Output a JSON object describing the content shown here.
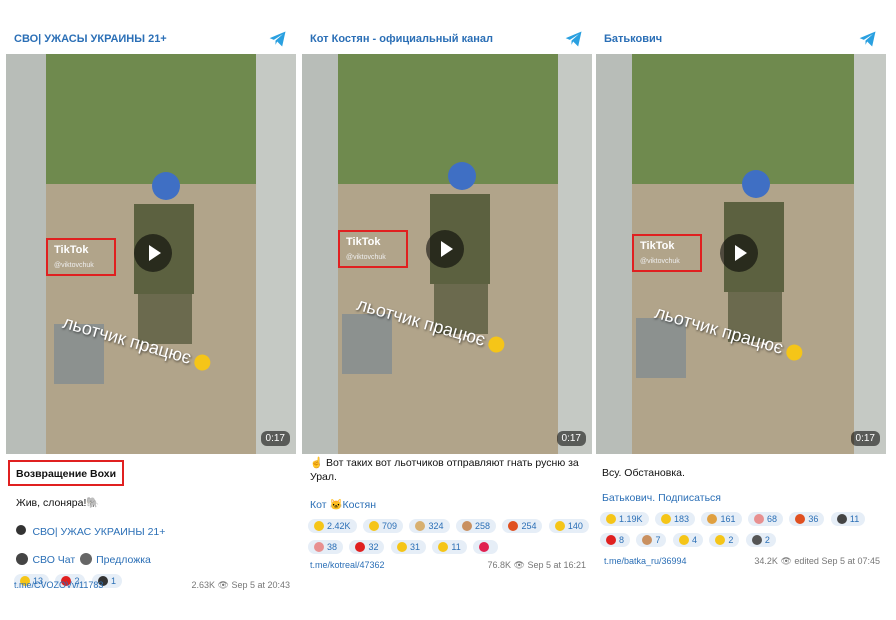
{
  "colors": {
    "accent": "#2b6fb6",
    "highlight": "#e02020"
  },
  "panels": [
    {
      "channel": "СВО| УЖАСЫ УКРАИНЫ 21+",
      "duration": "0:17",
      "tiktok_logo": "TikTok",
      "tiktok_user": "@viktovchuk",
      "overlay": "льотчик працює",
      "title": "Возвращение Вохи",
      "text": "Жив, слоняра!🐘",
      "line2": "СВО| УЖАС УКРАИНЫ 21+",
      "line3a": "СВО Чат",
      "line3b": "Предложка",
      "reactions": [
        "13",
        "2",
        "1"
      ],
      "link": "t.me/CVOZOVv/11783",
      "views": "2.63K",
      "date": "Sep 5 at 20:43"
    },
    {
      "channel": "Кот Костян - официальный канал",
      "duration": "0:17",
      "tiktok_logo": "TikTok",
      "tiktok_user": "@viktovchuk",
      "overlay": "льотчик працює",
      "text": "☝ Вот таких вот льотчиков отправляют гнать русню за Урал.",
      "signature": "Кот 🐱Костян",
      "reactions1": [
        "2.42K",
        "709",
        "324",
        "258",
        "254",
        "140"
      ],
      "reactions2": [
        "38",
        "32",
        "31",
        "11",
        ""
      ],
      "link": "t.me/kotreal/47362",
      "views": "76.8K",
      "date": "Sep 5 at 16:21"
    },
    {
      "channel": "Батькович",
      "duration": "0:17",
      "tiktok_logo": "TikTok",
      "tiktok_user": "@viktovchuk",
      "overlay": "льотчик працює",
      "text": "Всу. Обстановка.",
      "signature": "Батькович. Подписаться",
      "reactions1": [
        "1.19K",
        "183",
        "161",
        "68",
        "36",
        "11"
      ],
      "reactions2": [
        "8",
        "7",
        "4",
        "2",
        "2"
      ],
      "link": "t.me/batka_ru/36994",
      "views": "34.2K",
      "edited": "edited",
      "date": "Sep 5 at 07:45"
    }
  ]
}
